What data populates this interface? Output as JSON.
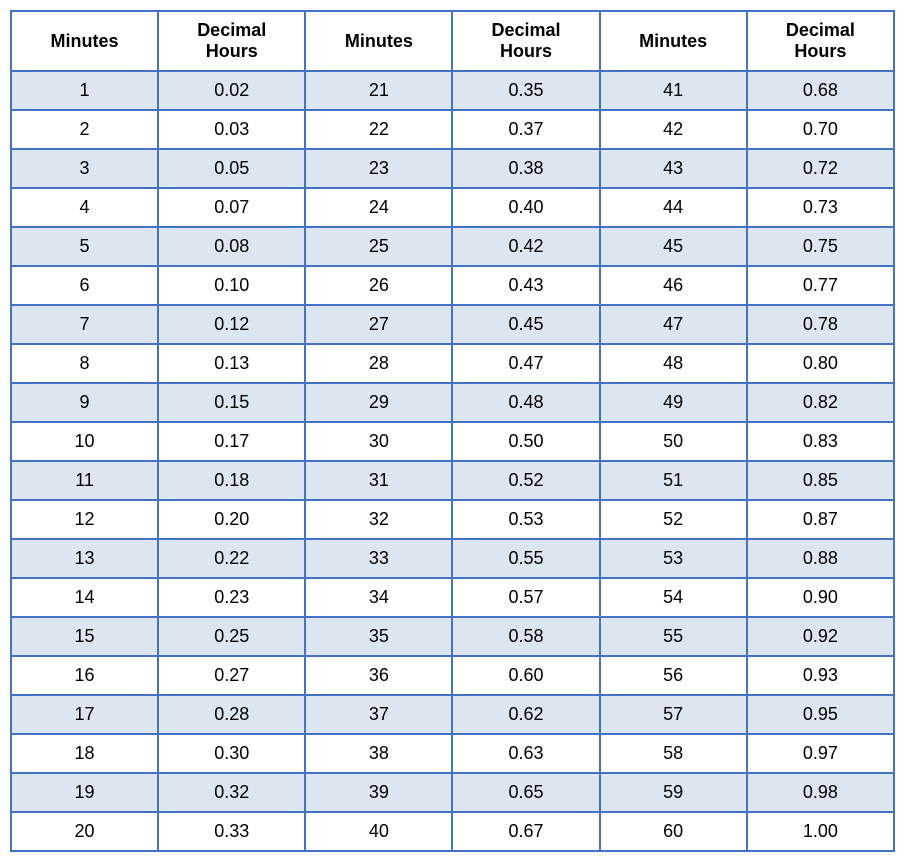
{
  "table": {
    "headers": [
      {
        "id": "min1",
        "label": "Minutes"
      },
      {
        "id": "dec1",
        "label": "Decimal\nHours"
      },
      {
        "id": "min2",
        "label": "Minutes"
      },
      {
        "id": "dec2",
        "label": "Decimal\nHours"
      },
      {
        "id": "min3",
        "label": "Minutes"
      },
      {
        "id": "dec3",
        "label": "Decimal\nHours"
      }
    ],
    "rows": [
      {
        "min1": "1",
        "dec1": "0.02",
        "min2": "21",
        "dec2": "0.35",
        "min3": "41",
        "dec3": "0.68"
      },
      {
        "min1": "2",
        "dec1": "0.03",
        "min2": "22",
        "dec2": "0.37",
        "min3": "42",
        "dec3": "0.70"
      },
      {
        "min1": "3",
        "dec1": "0.05",
        "min2": "23",
        "dec2": "0.38",
        "min3": "43",
        "dec3": "0.72"
      },
      {
        "min1": "4",
        "dec1": "0.07",
        "min2": "24",
        "dec2": "0.40",
        "min3": "44",
        "dec3": "0.73"
      },
      {
        "min1": "5",
        "dec1": "0.08",
        "min2": "25",
        "dec2": "0.42",
        "min3": "45",
        "dec3": "0.75"
      },
      {
        "min1": "6",
        "dec1": "0.10",
        "min2": "26",
        "dec2": "0.43",
        "min3": "46",
        "dec3": "0.77"
      },
      {
        "min1": "7",
        "dec1": "0.12",
        "min2": "27",
        "dec2": "0.45",
        "min3": "47",
        "dec3": "0.78"
      },
      {
        "min1": "8",
        "dec1": "0.13",
        "min2": "28",
        "dec2": "0.47",
        "min3": "48",
        "dec3": "0.80"
      },
      {
        "min1": "9",
        "dec1": "0.15",
        "min2": "29",
        "dec2": "0.48",
        "min3": "49",
        "dec3": "0.82"
      },
      {
        "min1": "10",
        "dec1": "0.17",
        "min2": "30",
        "dec2": "0.50",
        "min3": "50",
        "dec3": "0.83"
      },
      {
        "min1": "11",
        "dec1": "0.18",
        "min2": "31",
        "dec2": "0.52",
        "min3": "51",
        "dec3": "0.85"
      },
      {
        "min1": "12",
        "dec1": "0.20",
        "min2": "32",
        "dec2": "0.53",
        "min3": "52",
        "dec3": "0.87"
      },
      {
        "min1": "13",
        "dec1": "0.22",
        "min2": "33",
        "dec2": "0.55",
        "min3": "53",
        "dec3": "0.88"
      },
      {
        "min1": "14",
        "dec1": "0.23",
        "min2": "34",
        "dec2": "0.57",
        "min3": "54",
        "dec3": "0.90"
      },
      {
        "min1": "15",
        "dec1": "0.25",
        "min2": "35",
        "dec2": "0.58",
        "min3": "55",
        "dec3": "0.92"
      },
      {
        "min1": "16",
        "dec1": "0.27",
        "min2": "36",
        "dec2": "0.60",
        "min3": "56",
        "dec3": "0.93"
      },
      {
        "min1": "17",
        "dec1": "0.28",
        "min2": "37",
        "dec2": "0.62",
        "min3": "57",
        "dec3": "0.95"
      },
      {
        "min1": "18",
        "dec1": "0.30",
        "min2": "38",
        "dec2": "0.63",
        "min3": "58",
        "dec3": "0.97"
      },
      {
        "min1": "19",
        "dec1": "0.32",
        "min2": "39",
        "dec2": "0.65",
        "min3": "59",
        "dec3": "0.98"
      },
      {
        "min1": "20",
        "dec1": "0.33",
        "min2": "40",
        "dec2": "0.67",
        "min3": "60",
        "dec3": "1.00"
      }
    ]
  },
  "colors": {
    "stripe": "#dce6f1",
    "border": "#4472c4",
    "white": "#ffffff"
  }
}
